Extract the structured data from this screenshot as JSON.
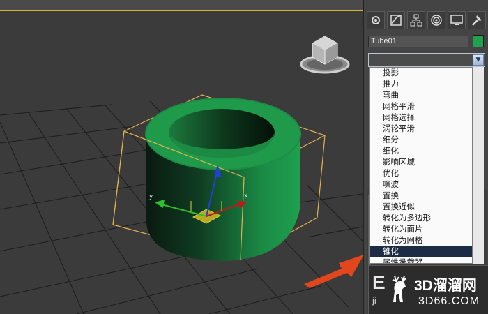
{
  "command_panel": {
    "tabs": [
      "create-icon",
      "modify-icon",
      "hierarchy-icon",
      "motion-icon",
      "display-icon",
      "utilities-icon"
    ],
    "object_name": "Tube01",
    "object_color": "#1fa14e"
  },
  "modifier_list": {
    "items": [
      "投影",
      "推力",
      "弯曲",
      "网格平滑",
      "网格选择",
      "涡轮平滑",
      "细分",
      "细化",
      "影响区域",
      "优化",
      "噪波",
      "置换",
      "置换近似",
      "转化为多边形",
      "转化为面片",
      "转化为网格",
      "锥化",
      "属性承载器"
    ],
    "selected_index": 16
  },
  "viewport": {
    "gizmo_labels": {
      "y": "y",
      "x": "x"
    },
    "tube_color": "#1e8c45",
    "bbox_color": "#e3b24c"
  },
  "annotation": {
    "arrow_color": "#e2461c"
  },
  "watermark": {
    "brand": "3D溜溜网",
    "url": "3D66.COM",
    "partial_left_1": "E",
    "partial_left_2": "ji"
  }
}
